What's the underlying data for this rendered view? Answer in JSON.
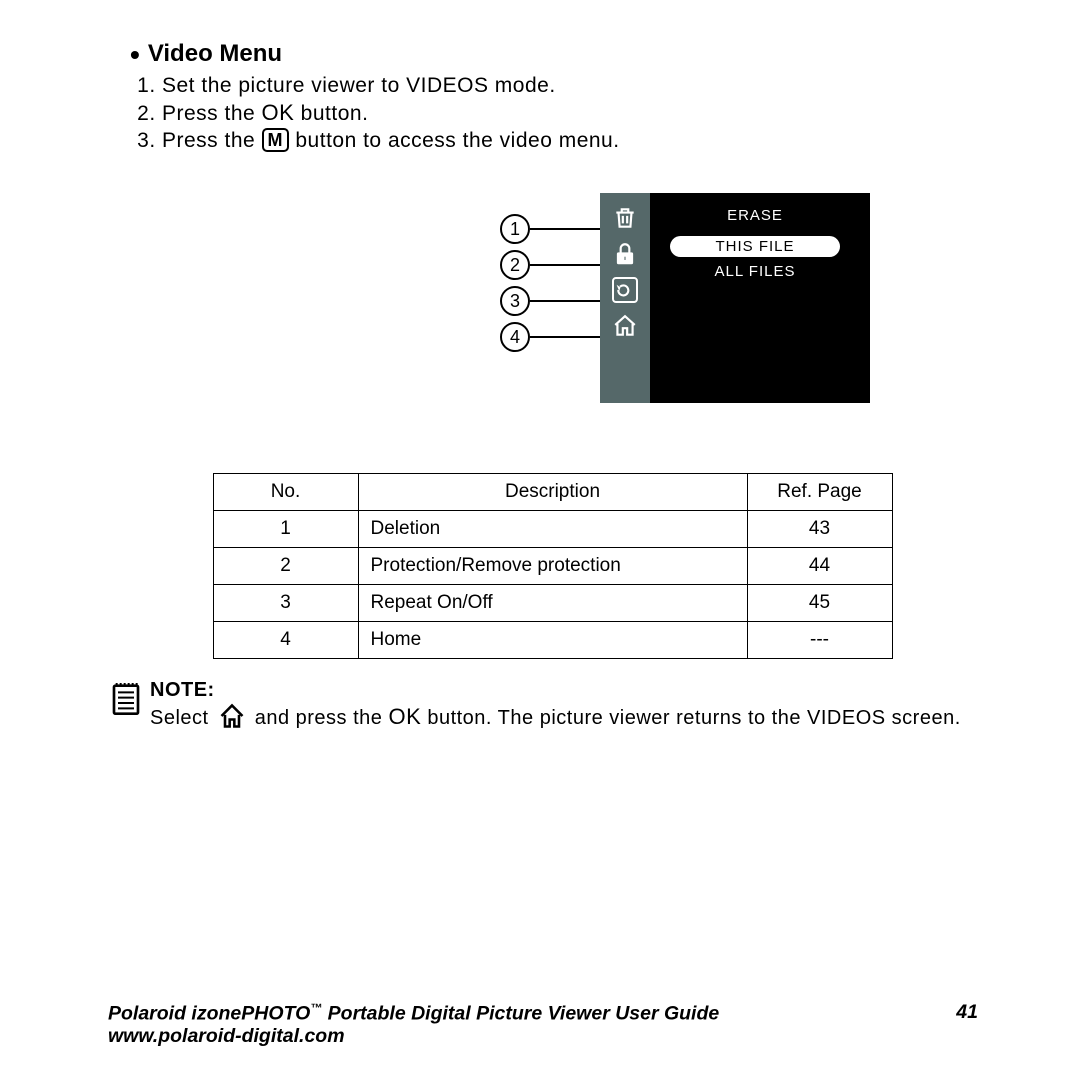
{
  "heading": "Video Menu",
  "steps": {
    "s1": "Set the picture viewer to VIDEOS mode.",
    "s2a": "Press the ",
    "s2b": " button.",
    "s3a": "Press the ",
    "s3b": " button to access the video menu."
  },
  "ok_label": "OK",
  "m_label": "M",
  "menu": {
    "title": "ERASE",
    "item_selected": "THIS FILE",
    "item_all": "ALL FILES"
  },
  "callouts": [
    "1",
    "2",
    "3",
    "4"
  ],
  "table": {
    "headers": {
      "no": "No.",
      "desc": "Description",
      "ref": "Ref. Page"
    },
    "rows": [
      {
        "no": "1",
        "desc": "Deletion",
        "ref": "43"
      },
      {
        "no": "2",
        "desc": "Protection/Remove protection",
        "ref": "44"
      },
      {
        "no": "3",
        "desc": "Repeat On/Off",
        "ref": "45"
      },
      {
        "no": "4",
        "desc": "Home",
        "ref": "---"
      }
    ]
  },
  "note": {
    "label": "NOTE:",
    "pre": "Select ",
    "mid": " and press the ",
    "post": " button. The picture viewer returns to the VIDEOS screen."
  },
  "footer": {
    "line1a": "Polaroid izonePHOTO",
    "tm": "™",
    "line1b": " Portable Digital Picture Viewer User Guide",
    "page": "41",
    "url": "www.polaroid-digital.com"
  }
}
